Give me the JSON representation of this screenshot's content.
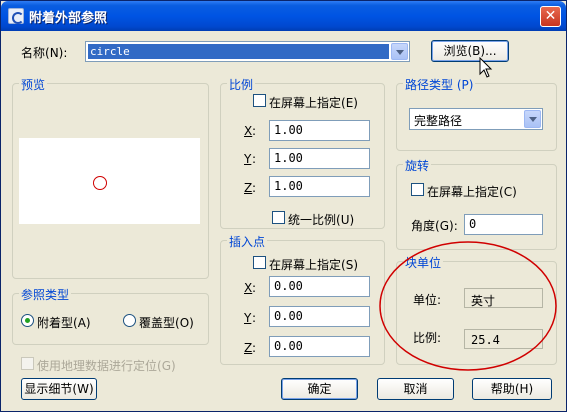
{
  "window": {
    "title": "附着外部参照",
    "close": "✕"
  },
  "name_row": {
    "label": "名称",
    "hotkey": "(N):",
    "value": "circle",
    "browse_label": "浏览",
    "browse_hotkey": "(B)..."
  },
  "preview": {
    "title": "预览"
  },
  "scale": {
    "title": "比例",
    "specify_label": "在屏幕上指定",
    "specify_hotkey": "(E)",
    "x_label": "X",
    "x_value": "1.00",
    "y_label": "Y",
    "y_value": "1.00",
    "z_label": "Z",
    "z_value": "1.00",
    "uniform_label": "统一比例",
    "uniform_hotkey": "(U)"
  },
  "insert": {
    "title": "插入点",
    "specify_label": "在屏幕上指定",
    "specify_hotkey": "(S)",
    "x_label": "X",
    "x_value": "0.00",
    "y_label": "Y",
    "y_value": "0.00",
    "z_label": "Z",
    "z_value": "0.00"
  },
  "path": {
    "title": "路径类型",
    "hotkey": "(P)",
    "value": "完整路径"
  },
  "rotation": {
    "title": "旋转",
    "specify_label": "在屏幕上指定",
    "specify_hotkey": "(C)",
    "angle_label": "角度",
    "angle_hotkey": "(G)",
    "angle_value": "0"
  },
  "block_unit": {
    "title": "块单位",
    "unit_label": "单位:",
    "unit_value": "英寸",
    "scale_label": "比例:",
    "scale_value": "25.4"
  },
  "ref_type": {
    "title": "参照类型",
    "attach_label": "附着型",
    "attach_hotkey": "(A)",
    "overlay_label": "覆盖型",
    "overlay_hotkey": "(O)"
  },
  "geo": {
    "label": "使用地理数据进行定位",
    "hotkey": "(G)"
  },
  "buttons": {
    "details": "显示细节",
    "details_hotkey": "(W)",
    "ok": "确定",
    "cancel": "取消",
    "help": "帮助",
    "help_hotkey": "(H)"
  },
  "colors": {
    "accent": "#0046d5",
    "title_bar": "#0054e3",
    "annotation": "#d00000"
  }
}
